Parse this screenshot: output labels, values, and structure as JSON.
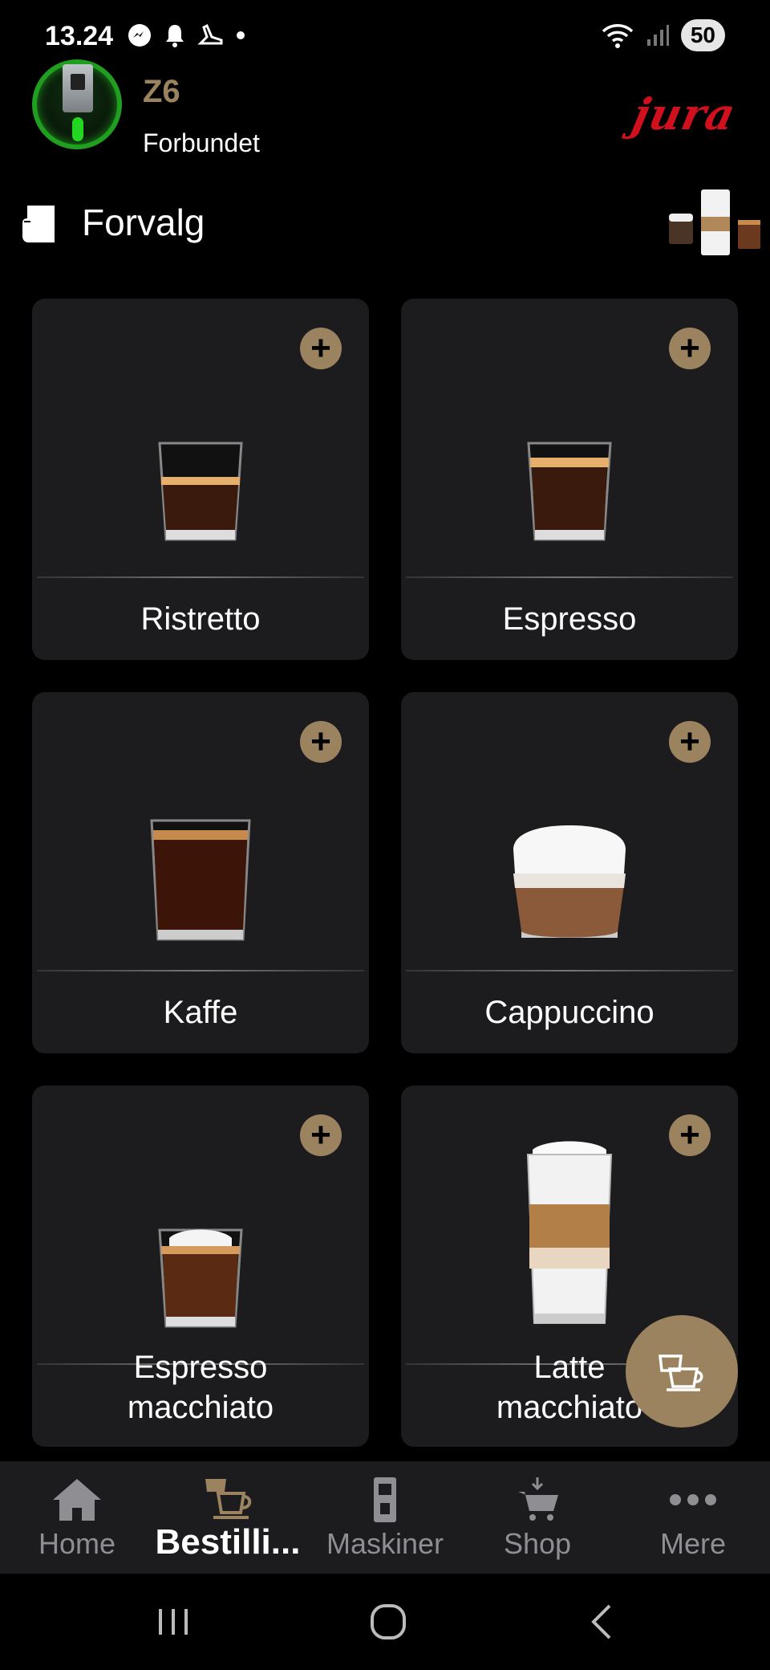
{
  "status_bar": {
    "time": "13.24",
    "battery": "50",
    "left_icons": [
      "messenger-icon",
      "bell-icon",
      "shoe-icon",
      "dot-icon"
    ],
    "right_icons": [
      "wifi-icon",
      "signal-icon",
      "battery-icon"
    ]
  },
  "header": {
    "machine_name": "Z6",
    "machine_status": "Forbundet",
    "brand": "jura",
    "brand_color": "#d0101c",
    "status_ring_color": "#1f9e1f"
  },
  "section": {
    "title": "Forvalg",
    "icon": "cup-icon"
  },
  "accent_color": "#9c8360",
  "products": [
    {
      "label": "Ristretto",
      "drink": "ristretto"
    },
    {
      "label": "Espresso",
      "drink": "espresso"
    },
    {
      "label": "Kaffe",
      "drink": "kaffe"
    },
    {
      "label": "Cappuccino",
      "drink": "cappuccino"
    },
    {
      "label_line1": "Espresso",
      "label_line2": "macchiato",
      "drink": "espresso-macchiato"
    },
    {
      "label_line1": "Latte",
      "label_line2": "macchiato",
      "drink": "latte-macchiato"
    }
  ],
  "add_symbol": "+",
  "bottom_nav": {
    "items": [
      {
        "label": "Home",
        "icon": "home-icon",
        "active": false
      },
      {
        "label": "Bestilli...",
        "icon": "order-icon",
        "active": true
      },
      {
        "label": "Maskiner",
        "icon": "machine-icon",
        "active": false
      },
      {
        "label": "Shop",
        "icon": "cart-icon",
        "active": false
      },
      {
        "label": "Mere",
        "icon": "more-icon",
        "active": false
      }
    ]
  },
  "system_nav": [
    "recent-apps-icon",
    "home-button-icon",
    "back-icon"
  ]
}
